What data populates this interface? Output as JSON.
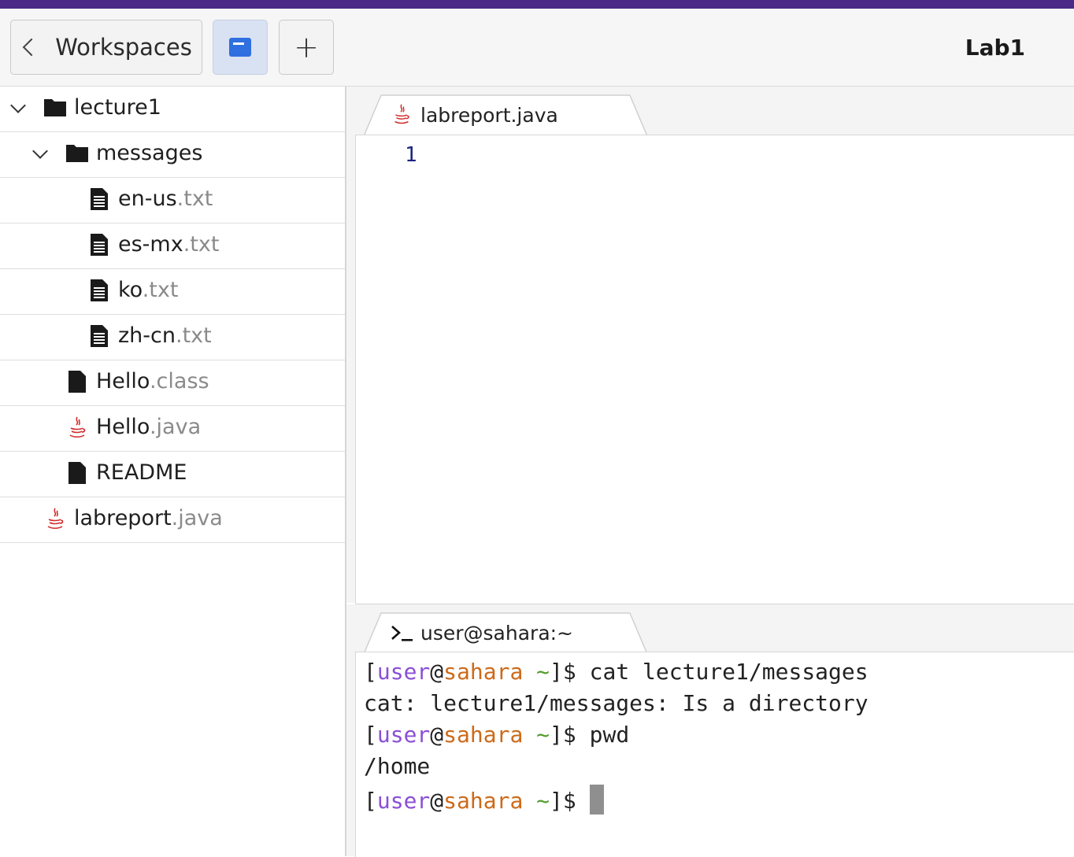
{
  "toolbar": {
    "workspaces_label": "Workspaces",
    "add_label": "+",
    "title": "Lab1"
  },
  "file_tree": {
    "items": [
      {
        "name": "lecture1",
        "ext": "",
        "type": "folder",
        "expanded": true
      },
      {
        "name": "messages",
        "ext": "",
        "type": "folder",
        "expanded": true
      },
      {
        "name": "en-us",
        "ext": ".txt",
        "type": "text-file"
      },
      {
        "name": "es-mx",
        "ext": ".txt",
        "type": "text-file"
      },
      {
        "name": "ko",
        "ext": ".txt",
        "type": "text-file"
      },
      {
        "name": "zh-cn",
        "ext": ".txt",
        "type": "text-file"
      },
      {
        "name": "Hello",
        "ext": ".class",
        "type": "file"
      },
      {
        "name": "Hello",
        "ext": ".java",
        "type": "java-file"
      },
      {
        "name": "README",
        "ext": "",
        "type": "file"
      },
      {
        "name": "labreport",
        "ext": ".java",
        "type": "java-file"
      }
    ]
  },
  "editor": {
    "tab_label": "labreport.java",
    "line_numbers": [
      "1"
    ]
  },
  "terminal": {
    "tab_label": "user@sahara:~",
    "prompt": {
      "user": "user",
      "at": "@",
      "host": "sahara",
      "dir": "~",
      "open": "[",
      "close": "]$ "
    },
    "lines": [
      {
        "kind": "command",
        "text": "cat lecture1/messages"
      },
      {
        "kind": "output",
        "text": "cat: lecture1/messages: Is a directory"
      },
      {
        "kind": "command",
        "text": "pwd"
      },
      {
        "kind": "output",
        "text": "/home"
      },
      {
        "kind": "prompt",
        "text": ""
      }
    ]
  },
  "colors": {
    "accent_stripe": "#4a2a86",
    "prompt_user": "#8a4fd6",
    "prompt_host": "#cc6a1a",
    "prompt_dir": "#4f9b2a",
    "line_number": "#1a237e"
  }
}
